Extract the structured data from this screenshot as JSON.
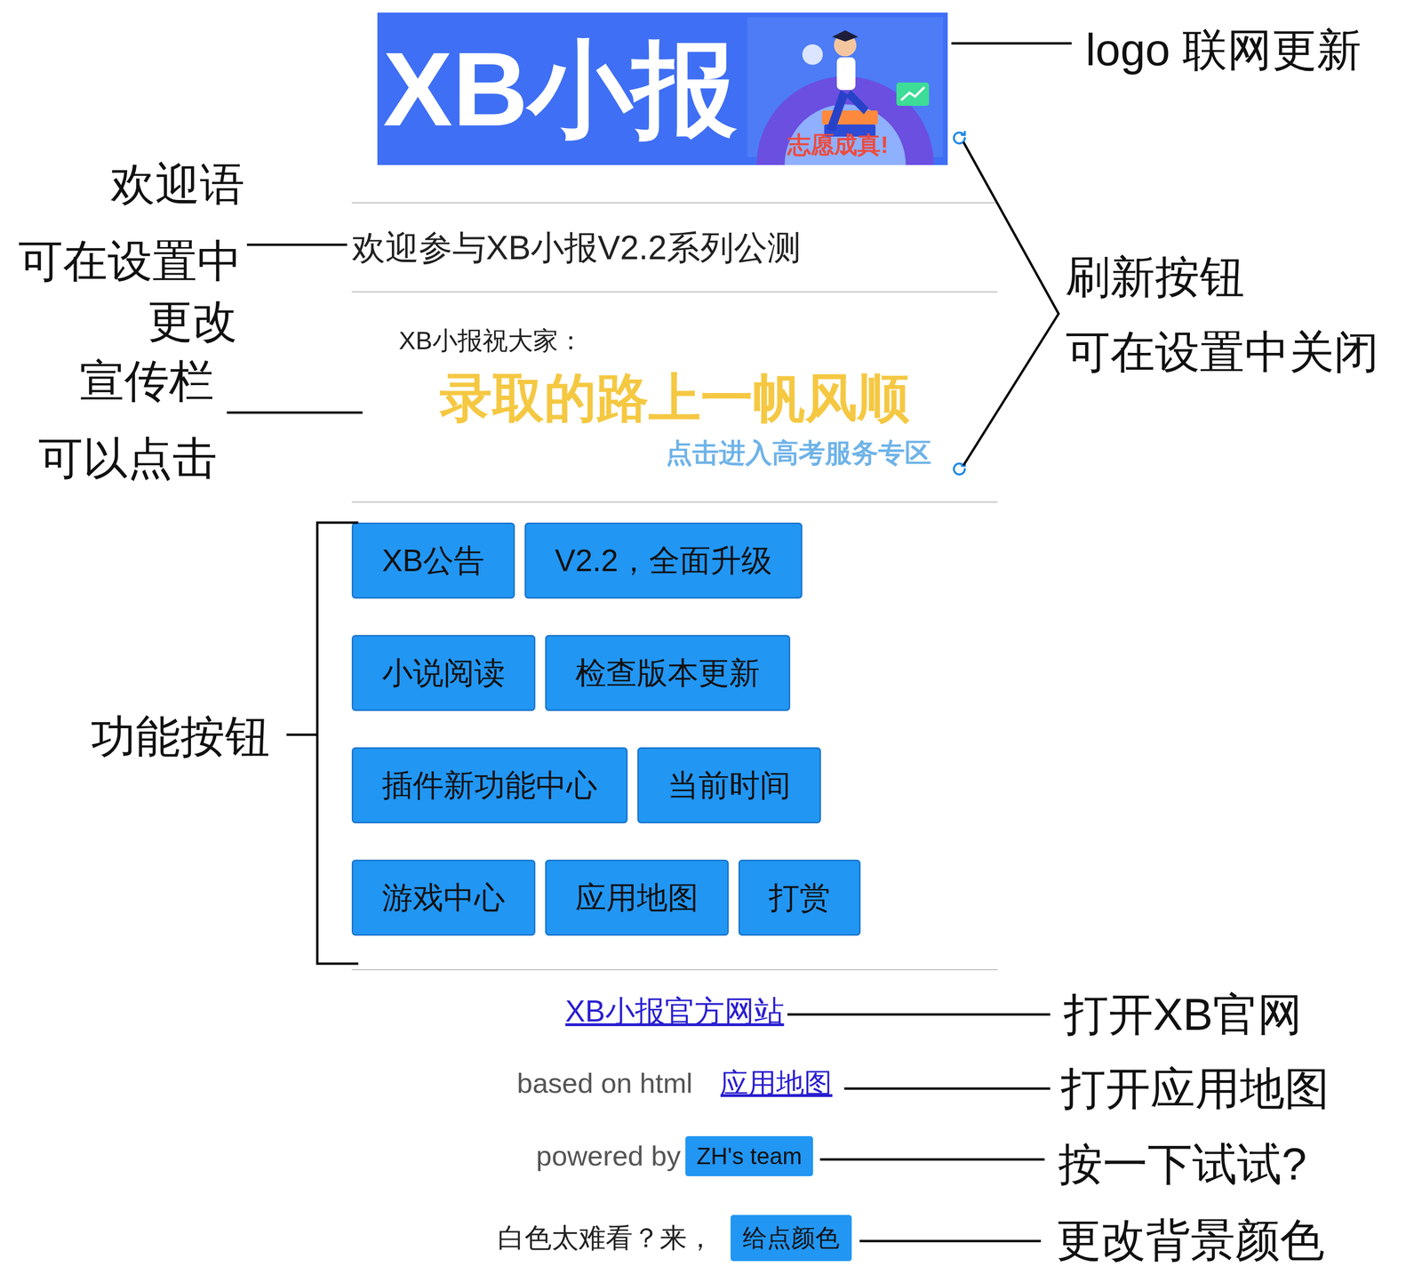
{
  "logo": {
    "title": "XB小报",
    "slogan": "志愿成真!"
  },
  "welcome": "欢迎参与XB小报V2.2系列公测",
  "promo": {
    "greeting": "XB小报祝大家：",
    "headline": "录取的路上一帆风顺",
    "link": "点击进入高考服务专区"
  },
  "function_buttons": [
    [
      {
        "label": "XB公告"
      },
      {
        "label": "V2.2，全面升级"
      }
    ],
    [
      {
        "label": "小说阅读"
      },
      {
        "label": "检查版本更新"
      }
    ],
    [
      {
        "label": "插件新功能中心"
      },
      {
        "label": "当前时间"
      }
    ],
    [
      {
        "label": "游戏中心"
      },
      {
        "label": "应用地图"
      },
      {
        "label": "打赏"
      }
    ]
  ],
  "footer": {
    "site_link": "XB小报官方网站",
    "based_on": "based on html",
    "map_link": "应用地图",
    "powered_by": "powered by",
    "team_button": "ZH's team",
    "color_prompt": "白色太难看？来，",
    "color_button": "给点颜色"
  },
  "annotations": [
    "logo 联网更新",
    "欢迎语",
    "可在设置中",
    "更改",
    "宣传栏",
    "可以点击",
    "刷新按钮",
    "可在设置中关闭",
    "功能按钮",
    "打开XB官网",
    "打开应用地图",
    "按一下试试?",
    "更改背景颜色"
  ]
}
